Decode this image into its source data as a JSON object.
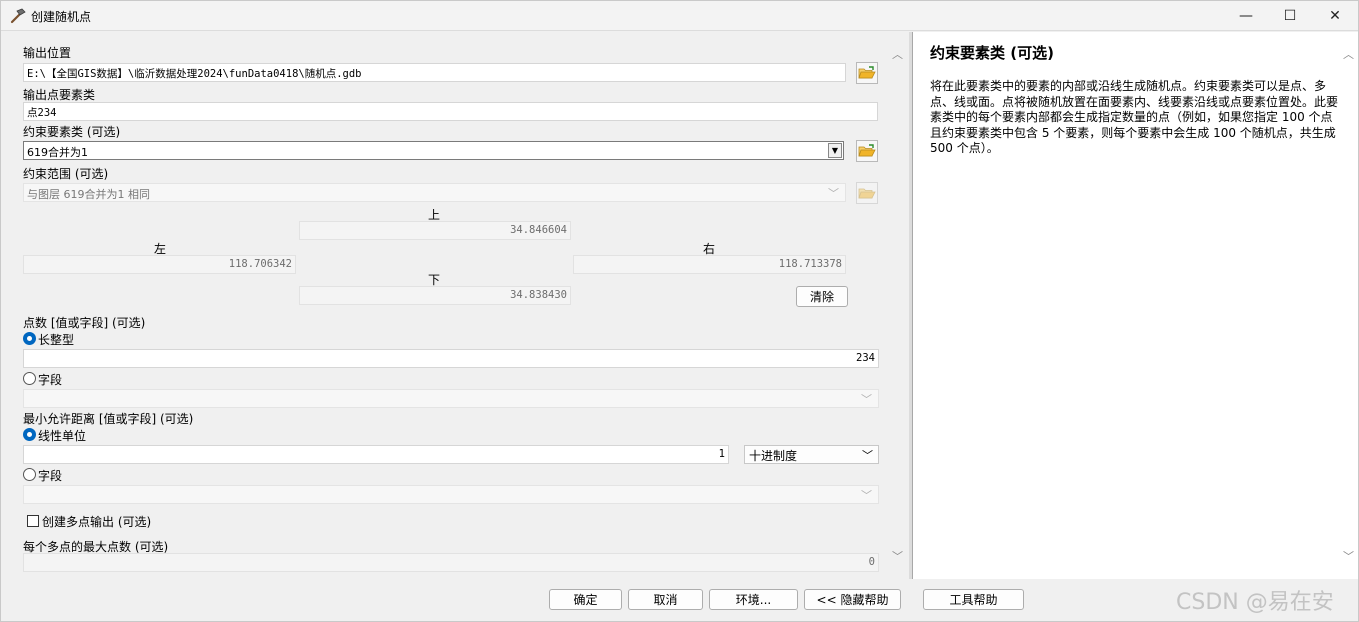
{
  "window": {
    "title": "创建随机点",
    "minimize_glyph": "—",
    "maximize_glyph": "☐",
    "close_glyph": "✕"
  },
  "form": {
    "output_location": {
      "label": "输出位置",
      "value": "E:\\【全国GIS数据】\\临沂数据处理2024\\funData0418\\随机点.gdb"
    },
    "output_fc": {
      "label": "输出点要素类",
      "value": "点234"
    },
    "constraint_fc": {
      "label": "约束要素类 (可选)",
      "value": "619合并为1"
    },
    "constraint_extent": {
      "label": "约束范围 (可选)",
      "value": "与图层 619合并为1 相同",
      "top_label": "上",
      "top": "34.846604",
      "left_label": "左",
      "left": "118.706342",
      "right_label": "右",
      "right": "118.713378",
      "bottom_label": "下",
      "bottom": "34.838430",
      "clear_button": "清除"
    },
    "point_count": {
      "label": "点数 [值或字段] (可选)",
      "long_label": "长整型",
      "long_value": "234",
      "field_label": "字段"
    },
    "min_distance": {
      "label": "最小允许距离 [值或字段] (可选)",
      "linear_label": "线性单位",
      "linear_value": "1",
      "unit": "十进制度",
      "field_label": "字段"
    },
    "multipoint": {
      "label": "创建多点输出 (可选)",
      "checked": false
    },
    "max_points": {
      "label": "每个多点的最大点数 (可选)",
      "value": "0"
    }
  },
  "help": {
    "title": "约束要素类 (可选)",
    "body": "将在此要素类中的要素的内部或沿线生成随机点。约束要素类可以是点、多点、线或面。点将被随机放置在面要素内、线要素沿线或点要素位置处。此要素类中的每个要素内部都会生成指定数量的点（例如，如果您指定 100 个点且约束要素类中包含 5 个要素，则每个要素中会生成 100 个随机点，共生成 500 个点）。"
  },
  "buttons": {
    "ok": "确定",
    "cancel": "取消",
    "env": "环境...",
    "hide_help": "<< 隐藏帮助",
    "tool_help": "工具帮助"
  },
  "watermark": "CSDN @易在安",
  "colors": {
    "accent": "#0067c0",
    "folder": "#e8b84a"
  }
}
